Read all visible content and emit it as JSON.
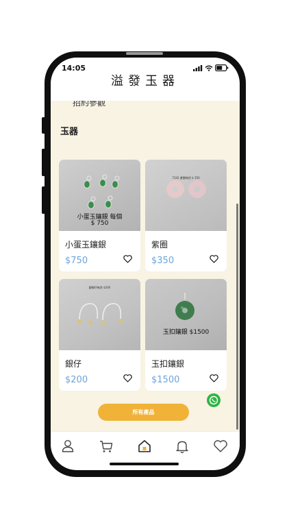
{
  "status_bar": {
    "time": "14:05"
  },
  "app": {
    "title": "溢發玉器"
  },
  "previous_section": {
    "label": "招約參觀"
  },
  "section": {
    "title": "玉器"
  },
  "products": [
    {
      "name": "小蛋玉鑲銀",
      "price": "$750",
      "image_caption": "小蛋玉鑲銀 每個",
      "image_caption_2": "$ 750"
    },
    {
      "name": "紫圈",
      "price": "$350",
      "image_caption": "7342  紫圈每對 $ 350"
    },
    {
      "name": "銀仔",
      "price": "$200",
      "image_caption": "銀細仔每對 $200"
    },
    {
      "name": "玉扣鑲銀",
      "price": "$1500",
      "image_caption": "玉扣鑲銀 $1500"
    }
  ],
  "buttons": {
    "all_products": "所有產品"
  },
  "tabbar": {
    "items": [
      "profile-icon",
      "cart-icon",
      "home-icon",
      "bell-icon",
      "heart-icon"
    ]
  },
  "colors": {
    "background": "#f8f3e3",
    "price": "#6aa4dc",
    "accent": "#f0b337",
    "whatsapp": "#2fb446"
  }
}
